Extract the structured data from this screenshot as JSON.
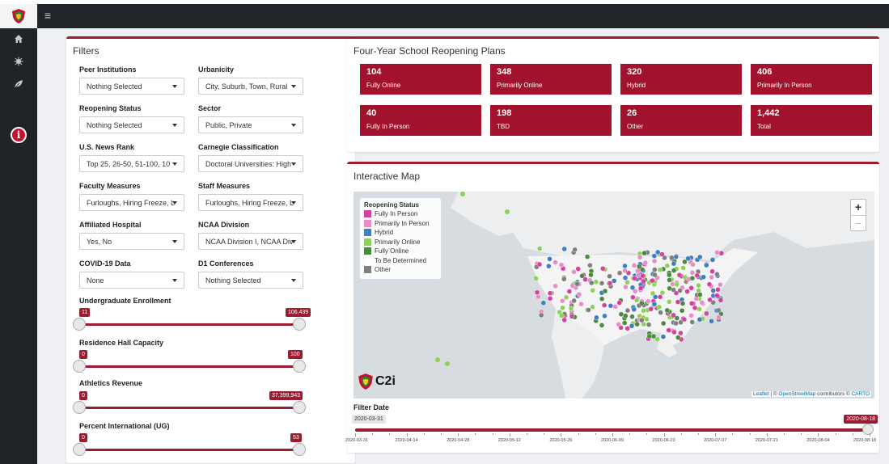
{
  "header": {
    "menu_icon": "hamburger-icon",
    "logo_icon": "shield-icon"
  },
  "sidebar": {
    "items": [
      "home-icon",
      "virus-icon",
      "leaf-icon",
      "info-icon"
    ],
    "info_glyph": "i"
  },
  "filters": {
    "title": "Filters",
    "selects": [
      {
        "label": "Peer Institutions",
        "value": "Nothing Selected"
      },
      {
        "label": "Urbanicity",
        "value": "City, Suburb, Town, Rural"
      },
      {
        "label": "Reopening Status",
        "value": "Nothing Selected"
      },
      {
        "label": "Sector",
        "value": "Public, Private"
      },
      {
        "label": "U.S. News Rank",
        "value": "Top 25, 26-50, 51-100, 10"
      },
      {
        "label": "Carnegie Classification",
        "value": "Doctoral Universities: High"
      },
      {
        "label": "Faculty Measures",
        "value": "Furloughs, Hiring Freeze, L"
      },
      {
        "label": "Staff Measures",
        "value": "Furloughs, Hiring Freeze, L"
      },
      {
        "label": "Affiliated Hospital",
        "value": "Yes, No"
      },
      {
        "label": "NCAA Division",
        "value": "NCAA Division I, NCAA Div"
      },
      {
        "label": "COVID-19 Data",
        "value": "None"
      },
      {
        "label": "D1 Conferences",
        "value": "Nothing Selected"
      }
    ],
    "sliders": [
      {
        "label": "Undergraduate Enrollment",
        "min": "11",
        "max": "106,439"
      },
      {
        "label": "Residence Hall Capacity",
        "min": "0",
        "max": "100"
      },
      {
        "label": "Athletics Revenue",
        "min": "0",
        "max": "37,399,943"
      },
      {
        "label": "Percent International (UG)",
        "min": "0",
        "max": "53"
      }
    ]
  },
  "plans": {
    "title": "Four-Year School Reopening Plans",
    "stats": [
      {
        "value": "104",
        "label": "Fully Online"
      },
      {
        "value": "348",
        "label": "Primarily Online"
      },
      {
        "value": "320",
        "label": "Hybrid"
      },
      {
        "value": "406",
        "label": "Primarily In Person"
      },
      {
        "value": "40",
        "label": "Fully In Person"
      },
      {
        "value": "198",
        "label": "TBD"
      },
      {
        "value": "26",
        "label": "Other"
      },
      {
        "value": "1,442",
        "label": "Total"
      }
    ]
  },
  "map": {
    "title": "Interactive Map",
    "legend_title": "Reopening Status",
    "legend": [
      {
        "label": "Fully In Person",
        "color": "#d6409f"
      },
      {
        "label": "Primarily In Person",
        "color": "#e88ec6"
      },
      {
        "label": "Hybrid",
        "color": "#3e7fbf"
      },
      {
        "label": "Primarily Online",
        "color": "#8fd05a"
      },
      {
        "label": "Fully Online",
        "color": "#4b8a3f"
      },
      {
        "label": "To Be Determined",
        "color": "#ffffff"
      },
      {
        "label": "Other",
        "color": "#7f7f7f"
      }
    ],
    "zoom_in": "+",
    "zoom_out": "−",
    "watermark": "C2i",
    "attribution": {
      "leaflet": "Leaflet",
      "sep1": " | © ",
      "osm": "OpenStreetMap",
      "mid": " contributors © ",
      "carto": "CARTO"
    }
  },
  "filter_date": {
    "label": "Filter Date",
    "start": "2020-03-31",
    "end": "2020-08-18",
    "ticks": [
      "2020-03-31",
      "2020-04-14",
      "2020-04-28",
      "2020-05-12",
      "2020-05-26",
      "2020-06-09",
      "2020-06-23",
      "2020-07-07",
      "2020-07-21",
      "2020-08-04",
      "2020-08-18"
    ]
  },
  "colors": {
    "accent": "#9b1b30",
    "stat_bg": "#a3122c",
    "topbar": "#212529"
  }
}
